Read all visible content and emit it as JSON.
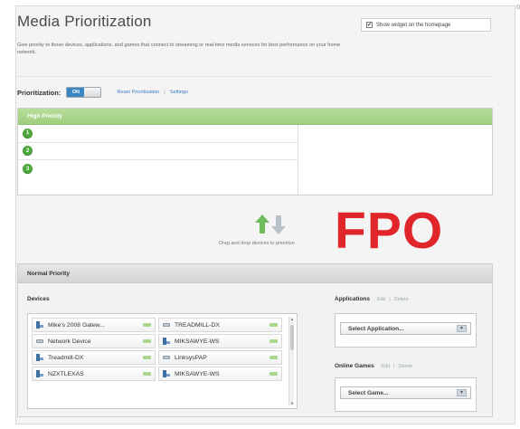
{
  "header": {
    "title": "Media Prioritization",
    "description": "Give priority to those devices, applications, and games that connect to streaming or real-time media services for best performance on your home network.",
    "show_widget_label": "Show widget on the homepage",
    "show_widget_checked": true,
    "corner_mark": "0"
  },
  "prioritization": {
    "label": "Prioritization:",
    "toggle_state": "ON",
    "reset_link": "Reset Prioritization",
    "separator": "|",
    "settings_link": "Settings"
  },
  "high_priority": {
    "title": "High Priority",
    "slots": [
      "1",
      "2",
      "3"
    ]
  },
  "drag_hint": "Drag and drop devices to prioritize",
  "fpo_text": "FPO",
  "normal_priority": {
    "title": "Normal Priority",
    "devices_label": "Devices",
    "devices": [
      {
        "name": "Mike's 2008 Gatew...",
        "icon": "pc-icon"
      },
      {
        "name": "TREADMILL-DX",
        "icon": "network-device-icon"
      },
      {
        "name": "Network Device",
        "icon": "network-device-icon"
      },
      {
        "name": "MIKSAWYE-WS",
        "icon": "pc-icon"
      },
      {
        "name": "Treadmill-DX",
        "icon": "pc-icon"
      },
      {
        "name": "LinksysPAP",
        "icon": "network-device-icon"
      },
      {
        "name": "NZXTLEXAS",
        "icon": "pc-icon"
      },
      {
        "name": "MIKSAWYE-WS",
        "icon": "pc-icon"
      }
    ],
    "applications": {
      "label": "Applications",
      "edit": "Edit",
      "separator": "|",
      "delete": "Delete",
      "select_placeholder": "Select Application..."
    },
    "online_games": {
      "label": "Online Games",
      "edit": "Edit",
      "separator": "|",
      "delete": "Delete",
      "select_placeholder": "Select Game..."
    }
  },
  "colors": {
    "high_priority_green": "#9fcf7e",
    "toggle_blue": "#3a86c4",
    "fpo_red": "#e0262b",
    "link_blue": "#3a7bbf"
  }
}
